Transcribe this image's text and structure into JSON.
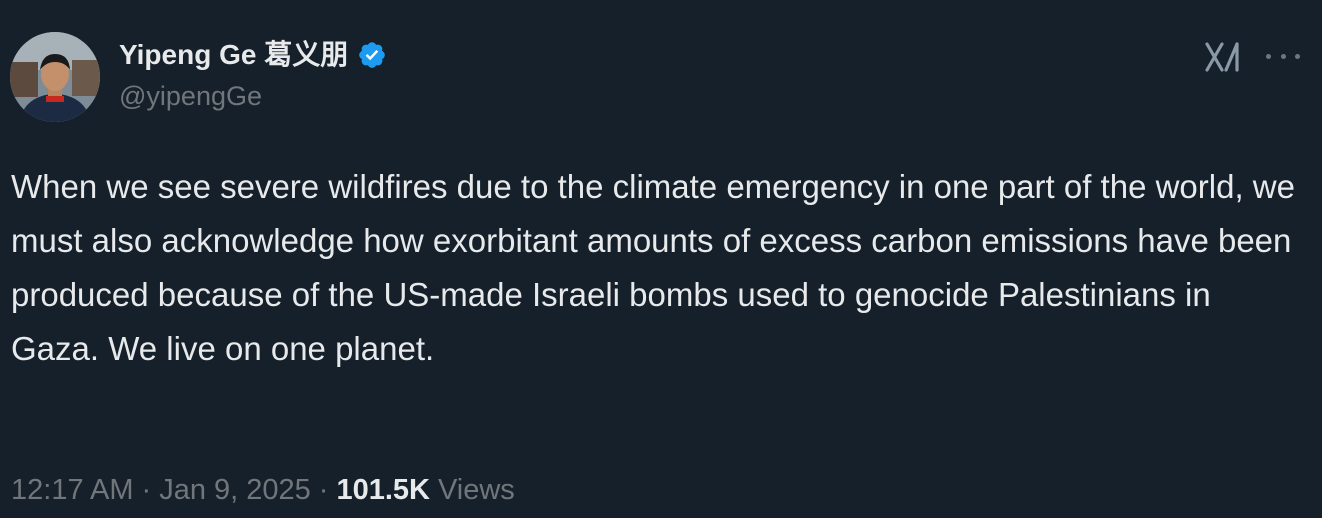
{
  "author": {
    "display_name": "Yipeng Ge 葛义朋",
    "handle": "@yipengGe",
    "verified": true,
    "verified_color": "#1d9bf0"
  },
  "tweet": {
    "text": "When we see severe wildfires due to the climate emergency in one part of the world, we must also acknowledge how exorbitant amounts of excess carbon emissions have been produced because of the US-made Israeli bombs used to genocide Palestinians in Gaza. We live on one planet."
  },
  "meta": {
    "time": "12:17 AM",
    "separator": "·",
    "date": "Jan 9, 2025",
    "views_count": "101.5K",
    "views_label": "Views"
  },
  "icons": {
    "brand": "x-logo-icon",
    "more": "more-options-icon",
    "verified": "verified-badge-icon"
  },
  "colors": {
    "background": "#15202b",
    "text_primary": "#e7e9ea",
    "text_secondary": "#71767b",
    "accent": "#1d9bf0"
  }
}
